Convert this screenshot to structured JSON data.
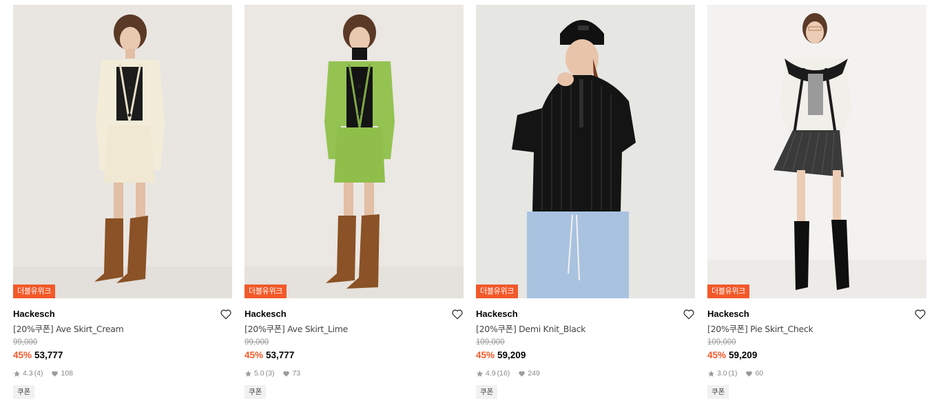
{
  "products": [
    {
      "badge": "더블유위크",
      "brand": "Hackesch",
      "name": "[20%쿠폰] Ave Skirt_Cream",
      "original_price": "99,000",
      "discount": "45%",
      "price": "53,777",
      "rating": "4.3",
      "reviews": "(4)",
      "likes": "108",
      "tag": "쿠폰",
      "image": "model-cream-tweed-set"
    },
    {
      "badge": "더블유위크",
      "brand": "Hackesch",
      "name": "[20%쿠폰] Ave Skirt_Lime",
      "original_price": "99,000",
      "discount": "45%",
      "price": "53,777",
      "rating": "5.0",
      "reviews": "(3)",
      "likes": "73",
      "tag": "쿠폰",
      "image": "model-lime-tweed-set"
    },
    {
      "badge": "더블유위크",
      "brand": "Hackesch",
      "name": "[20%쿠폰] Demi Knit_Black",
      "original_price": "109,000",
      "discount": "45%",
      "price": "59,209",
      "rating": "4.9",
      "reviews": "(16)",
      "likes": "249",
      "tag": "쿠폰",
      "image": "model-black-knit"
    },
    {
      "badge": "더블유위크",
      "brand": "Hackesch",
      "name": "[20%쿠폰] Pie Skirt_Check",
      "original_price": "109,000",
      "discount": "45%",
      "price": "59,209",
      "rating": "3.0",
      "reviews": "(1)",
      "likes": "60",
      "tag": "쿠폰",
      "image": "model-check-pleated-skirt"
    }
  ],
  "colors": {
    "accent": "#f2592a",
    "muted": "#888888",
    "strike": "#9a9a9a"
  }
}
